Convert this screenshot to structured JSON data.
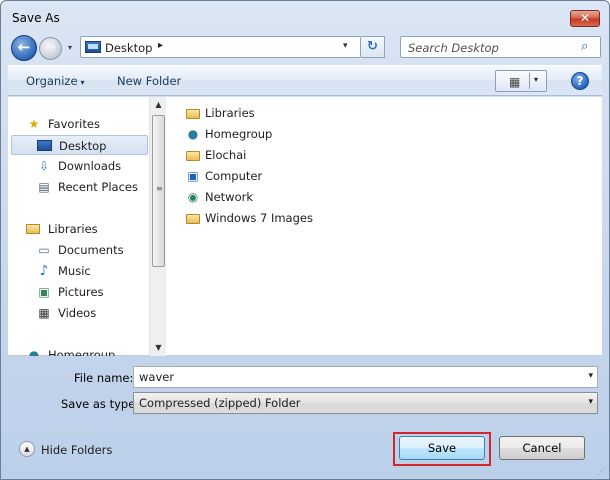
{
  "window": {
    "title": "Save As",
    "close_label": "✕"
  },
  "nav": {
    "back_glyph": "←",
    "forward_glyph": "→",
    "history_glyph": "▾",
    "address": {
      "location": "Desktop",
      "separator": "▸",
      "dropdown": "▾"
    },
    "refresh_glyph": "↻",
    "search": {
      "placeholder": "Search Desktop",
      "icon": "search-icon"
    }
  },
  "command_bar": {
    "organize_label": "Organize",
    "organize_arrow": "▾",
    "new_folder_label": "New Folder",
    "views_icon": "▦",
    "views_arrow": "▾",
    "help_glyph": "?"
  },
  "nav_pane": {
    "items": [
      {
        "label": "Favorites",
        "icon": "★"
      },
      {
        "label": "Desktop",
        "icon": "desktop-icon"
      },
      {
        "label": "Downloads",
        "icon": "⇩"
      },
      {
        "label": "Recent Places",
        "icon": "▤"
      },
      {
        "label": "Libraries",
        "icon": "library-icon"
      },
      {
        "label": "Documents",
        "icon": "▭"
      },
      {
        "label": "Music",
        "icon": "♪"
      },
      {
        "label": "Pictures",
        "icon": "▣"
      },
      {
        "label": "Videos",
        "icon": "▦"
      },
      {
        "label": "Homegroup",
        "icon": "●"
      }
    ],
    "scroll_up": "▲",
    "scroll_down": "▼",
    "scroll_grip": "≡"
  },
  "files": [
    {
      "label": "Libraries",
      "icon": "folder"
    },
    {
      "label": "Homegroup",
      "icon": "homegroup"
    },
    {
      "label": "Elochai",
      "icon": "user-folder"
    },
    {
      "label": "Computer",
      "icon": "computer"
    },
    {
      "label": "Network",
      "icon": "network"
    },
    {
      "label": "Windows 7 Images",
      "icon": "folder"
    }
  ],
  "form": {
    "file_name_label": "File name:",
    "file_name_value": "waver",
    "save_type_label": "Save as type:",
    "save_type_value": "Compressed (zipped) Folder",
    "dropdown_glyph": "▾"
  },
  "footer": {
    "hide_folders_label": "Hide Folders",
    "hide_folders_glyph": "▲",
    "save_label": "Save",
    "cancel_label": "Cancel",
    "accent_highlight": "#d2262c"
  }
}
